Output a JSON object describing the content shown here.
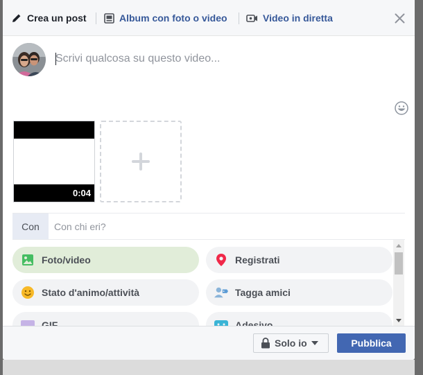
{
  "tabs": {
    "create_post": "Crea un post",
    "album": "Album con foto o video",
    "live_video": "Video in diretta"
  },
  "composer": {
    "placeholder": "Scrivi qualcosa su questo video..."
  },
  "media": {
    "video_duration": "0:04"
  },
  "with": {
    "label": "Con",
    "placeholder": "Con chi eri?"
  },
  "actions": [
    {
      "label": "Foto/video",
      "icon": "photo-icon"
    },
    {
      "label": "Registrati",
      "icon": "location-pin-icon"
    },
    {
      "label": "Stato d'animo/attività",
      "icon": "smiley-icon"
    },
    {
      "label": "Tagga amici",
      "icon": "tag-friends-icon"
    },
    {
      "label": "GIF",
      "icon": "gif-icon"
    },
    {
      "label": "Adesivo",
      "icon": "sticker-icon"
    }
  ],
  "footer": {
    "privacy_label": "Solo io",
    "publish_label": "Pubblica"
  },
  "colors": {
    "brand": "#4267b2",
    "link": "#365899",
    "active_action_bg": "#e1edd9",
    "location_pin": "#f02849"
  }
}
